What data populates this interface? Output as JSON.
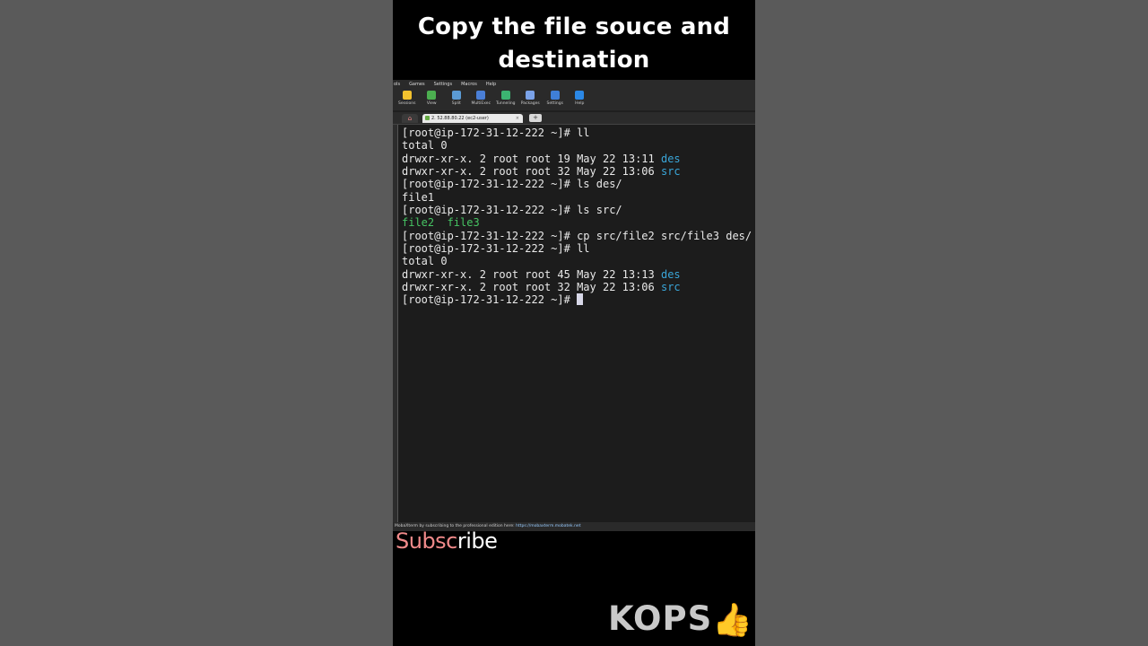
{
  "headline": "Copy the file souce and destination",
  "menu": [
    "ols",
    "Games",
    "Settings",
    "Macros",
    "Help"
  ],
  "toolbar": [
    {
      "label": "Sessions",
      "icon": "star-icon",
      "color": "#f2c12e"
    },
    {
      "label": "View",
      "icon": "monitor-icon",
      "color": "#4caf50"
    },
    {
      "label": "Split",
      "icon": "split-icon",
      "color": "#5b9bd5"
    },
    {
      "label": "MultiExec",
      "icon": "fork-icon",
      "color": "#4a7fd6"
    },
    {
      "label": "Tunneling",
      "icon": "tunnel-icon",
      "color": "#3cb371"
    },
    {
      "label": "Packages",
      "icon": "packages-icon",
      "color": "#7aa2e8"
    },
    {
      "label": "Settings",
      "icon": "gears-icon",
      "color": "#3f7fd8"
    },
    {
      "label": "Help",
      "icon": "help-icon",
      "color": "#2b88e6"
    }
  ],
  "tab": {
    "title": "2. 52.88.80.22 (ec2-user)",
    "close": "×",
    "new": "+"
  },
  "terminal": {
    "prompt": "[root@ip-172-31-12-222 ~]# ",
    "lines": [
      {
        "parts": [
          {
            "t": "[root@ip-172-31-12-222 ~]# ll",
            "c": ""
          }
        ]
      },
      {
        "parts": [
          {
            "t": "total 0",
            "c": ""
          }
        ]
      },
      {
        "parts": [
          {
            "t": "drwxr-xr-x. 2 root root 19 May 22 13:11 ",
            "c": ""
          },
          {
            "t": "des",
            "c": "blue"
          }
        ]
      },
      {
        "parts": [
          {
            "t": "drwxr-xr-x. 2 root root 32 May 22 13:06 ",
            "c": ""
          },
          {
            "t": "src",
            "c": "blue"
          }
        ]
      },
      {
        "parts": [
          {
            "t": "[root@ip-172-31-12-222 ~]# ls des/",
            "c": ""
          }
        ]
      },
      {
        "parts": [
          {
            "t": "file1",
            "c": ""
          }
        ]
      },
      {
        "parts": [
          {
            "t": "[root@ip-172-31-12-222 ~]# ls src/",
            "c": ""
          }
        ]
      },
      {
        "parts": [
          {
            "t": "file2  file3",
            "c": "green"
          }
        ]
      },
      {
        "parts": [
          {
            "t": "[root@ip-172-31-12-222 ~]# cp src/file2 src/file3 des/",
            "c": ""
          }
        ]
      },
      {
        "parts": [
          {
            "t": "[root@ip-172-31-12-222 ~]# ll",
            "c": ""
          }
        ]
      },
      {
        "parts": [
          {
            "t": "total 0",
            "c": ""
          }
        ]
      },
      {
        "parts": [
          {
            "t": "drwxr-xr-x. 2 root root 45 May 22 13:13 ",
            "c": ""
          },
          {
            "t": "des",
            "c": "blue"
          }
        ]
      },
      {
        "parts": [
          {
            "t": "drwxr-xr-x. 2 root root 32 May 22 13:06 ",
            "c": ""
          },
          {
            "t": "src",
            "c": "blue"
          }
        ]
      },
      {
        "parts": [
          {
            "t": "[root@ip-172-31-12-222 ~]# ",
            "c": ""
          }
        ],
        "cursor": true
      }
    ]
  },
  "statusbar": {
    "text": "MobaXterm by subscribing to the professional edition here: ",
    "link": "https://mobaxterm.mobatek.net"
  },
  "overlay": {
    "subscribe_a": "Subsc",
    "subscribe_b": "ribe",
    "brand": "KOPS",
    "thumb": "👍"
  },
  "colors": {
    "blue": "#3aa6d9",
    "green": "#46c463",
    "accent_pink": "#f08a8a"
  }
}
